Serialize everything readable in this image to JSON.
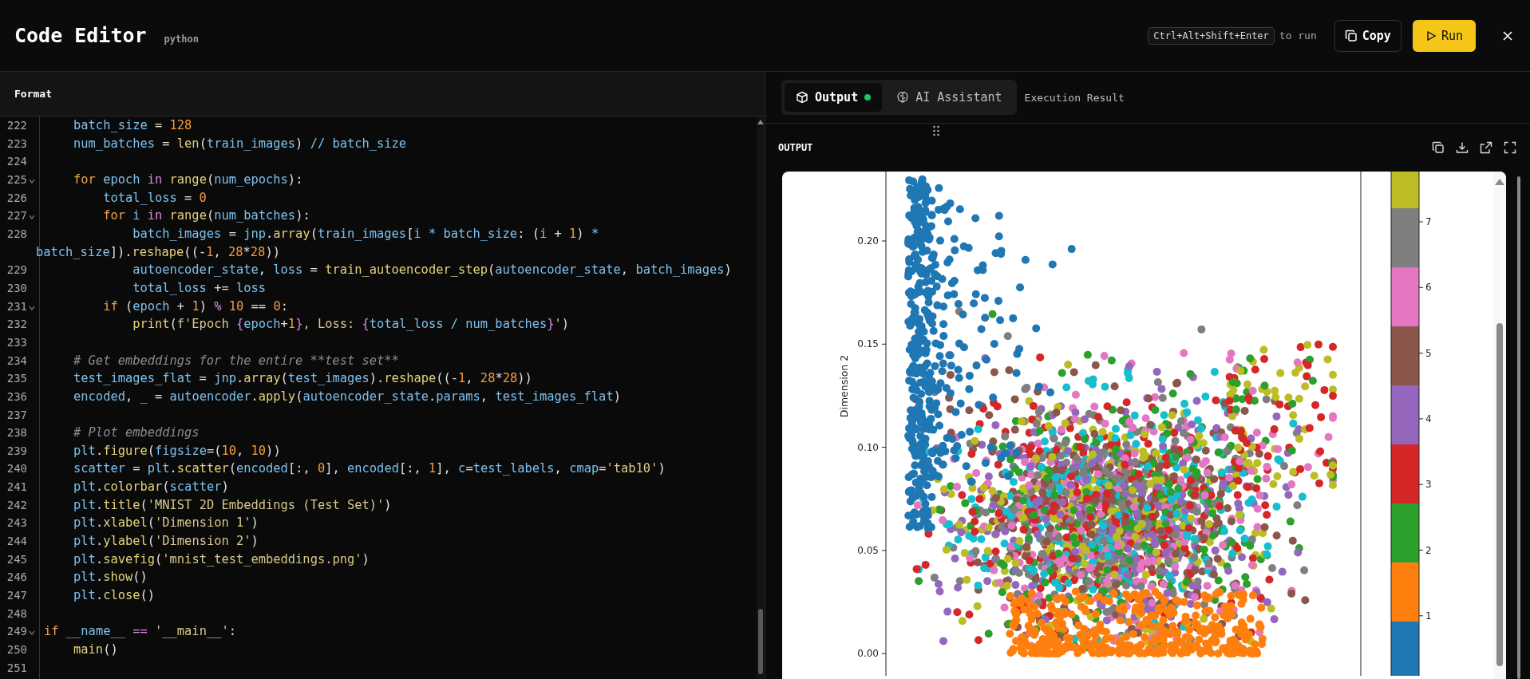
{
  "header": {
    "title": "Code Editor",
    "language": "python",
    "shortcut": "Ctrl+Alt+Shift+Enter",
    "shortcut_hint": "to run",
    "copy_button": "Copy",
    "run_button": "Run"
  },
  "editor": {
    "toolbar_label": "Format",
    "lines": [
      {
        "n": "222",
        "fold": false,
        "tokens": [
          {
            "text": "    batch_size",
            "kind": "variable"
          },
          {
            "text": " = ",
            "kind": "plain"
          },
          {
            "text": "128",
            "kind": "number"
          }
        ]
      },
      {
        "n": "223",
        "fold": false,
        "tokens": [
          {
            "text": "    num_batches",
            "kind": "variable"
          },
          {
            "text": " = ",
            "kind": "plain"
          },
          {
            "text": "len",
            "kind": "function"
          },
          {
            "text": "(",
            "kind": "plain"
          },
          {
            "text": "train_images",
            "kind": "variable"
          },
          {
            "text": ") ",
            "kind": "plain"
          },
          {
            "text": "// batch_size",
            "kind": "variable"
          }
        ]
      },
      {
        "n": "224",
        "fold": false
      },
      {
        "n": "225",
        "fold": true,
        "tokens": [
          {
            "text": "    for",
            "kind": "keyword"
          },
          {
            "text": " epoch ",
            "kind": "variable"
          },
          {
            "text": "in",
            "kind": "operator"
          },
          {
            "text": " range",
            "kind": "function"
          },
          {
            "text": "(",
            "kind": "plain"
          },
          {
            "text": "num_epochs",
            "kind": "variable"
          },
          {
            "text": "):",
            "kind": "plain"
          }
        ]
      },
      {
        "n": "226",
        "fold": false,
        "tokens": [
          {
            "text": "        total_loss",
            "kind": "variable"
          },
          {
            "text": " = ",
            "kind": "plain"
          },
          {
            "text": "0",
            "kind": "number"
          }
        ]
      },
      {
        "n": "227",
        "fold": true,
        "tokens": [
          {
            "text": "        for",
            "kind": "keyword"
          },
          {
            "text": " i ",
            "kind": "variable"
          },
          {
            "text": "in",
            "kind": "operator"
          },
          {
            "text": " range",
            "kind": "function"
          },
          {
            "text": "(",
            "kind": "plain"
          },
          {
            "text": "num_batches",
            "kind": "variable"
          },
          {
            "text": "):",
            "kind": "plain"
          }
        ]
      },
      {
        "n": "228",
        "fold": false,
        "tokens": [
          {
            "text": "            batch_images",
            "kind": "variable"
          },
          {
            "text": " = ",
            "kind": "plain"
          },
          {
            "text": "jnp",
            "kind": "variable"
          },
          {
            "text": ".",
            "kind": "plain"
          },
          {
            "text": "array",
            "kind": "function"
          },
          {
            "text": "(",
            "kind": "plain"
          },
          {
            "text": "train_images",
            "kind": "variable"
          },
          {
            "text": "[",
            "kind": "plain"
          },
          {
            "text": "i * batch_size",
            "kind": "variable"
          },
          {
            "text": ": (",
            "kind": "plain"
          },
          {
            "text": "i",
            "kind": "variable"
          },
          {
            "text": " + ",
            "kind": "plain"
          },
          {
            "text": "1",
            "kind": "number"
          },
          {
            "text": ") ",
            "kind": "plain"
          },
          {
            "text": "*",
            "kind": "variable"
          }
        ],
        "continuation": [
          {
            "text": "batch_size",
            "kind": "variable"
          },
          {
            "text": "]).",
            "kind": "plain"
          },
          {
            "text": "reshape",
            "kind": "function"
          },
          {
            "text": "((-",
            "kind": "plain"
          },
          {
            "text": "1",
            "kind": "number"
          },
          {
            "text": ", ",
            "kind": "plain"
          },
          {
            "text": "28",
            "kind": "number"
          },
          {
            "text": "*",
            "kind": "plain"
          },
          {
            "text": "28",
            "kind": "number"
          },
          {
            "text": "))",
            "kind": "plain"
          }
        ]
      },
      {
        "n": "229",
        "fold": false,
        "tokens": [
          {
            "text": "            autoencoder_state",
            "kind": "variable"
          },
          {
            "text": ", ",
            "kind": "plain"
          },
          {
            "text": "loss",
            "kind": "variable"
          },
          {
            "text": " = ",
            "kind": "plain"
          },
          {
            "text": "train_autoencoder_step",
            "kind": "function"
          },
          {
            "text": "(",
            "kind": "plain"
          },
          {
            "text": "autoencoder_state",
            "kind": "variable"
          },
          {
            "text": ", ",
            "kind": "plain"
          },
          {
            "text": "batch_images",
            "kind": "variable"
          },
          {
            "text": ")",
            "kind": "plain"
          }
        ]
      },
      {
        "n": "230",
        "fold": false,
        "tokens": [
          {
            "text": "            total_loss",
            "kind": "variable"
          },
          {
            "text": " += ",
            "kind": "plain"
          },
          {
            "text": "loss",
            "kind": "variable"
          }
        ]
      },
      {
        "n": "231",
        "fold": true,
        "tokens": [
          {
            "text": "        if",
            "kind": "keyword"
          },
          {
            "text": " (",
            "kind": "plain"
          },
          {
            "text": "epoch",
            "kind": "variable"
          },
          {
            "text": " + ",
            "kind": "plain"
          },
          {
            "text": "1",
            "kind": "number"
          },
          {
            "text": ") ",
            "kind": "plain"
          },
          {
            "text": "%",
            "kind": "operator"
          },
          {
            "text": " 10",
            "kind": "number"
          },
          {
            "text": " == ",
            "kind": "plain"
          },
          {
            "text": "0",
            "kind": "number"
          },
          {
            "text": ":",
            "kind": "plain"
          }
        ]
      },
      {
        "n": "232",
        "fold": false,
        "tokens": [
          {
            "text": "            print",
            "kind": "function"
          },
          {
            "text": "(",
            "kind": "plain"
          },
          {
            "text": "f'Epoch ",
            "kind": "string"
          },
          {
            "text": "{",
            "kind": "operator"
          },
          {
            "text": "epoch",
            "kind": "variable"
          },
          {
            "text": "+",
            "kind": "plain"
          },
          {
            "text": "1",
            "kind": "number"
          },
          {
            "text": "}",
            "kind": "operator"
          },
          {
            "text": ", Loss: ",
            "kind": "string"
          },
          {
            "text": "{",
            "kind": "operator"
          },
          {
            "text": "total_loss / num_batches",
            "kind": "variable"
          },
          {
            "text": "}",
            "kind": "operator"
          },
          {
            "text": "'",
            "kind": "string"
          },
          {
            "text": ")",
            "kind": "plain"
          }
        ]
      },
      {
        "n": "233",
        "fold": false
      },
      {
        "n": "234",
        "fold": false,
        "tokens": [
          {
            "text": "    # Get embeddings for the entire **test set**",
            "kind": "comment"
          }
        ]
      },
      {
        "n": "235",
        "fold": false,
        "tokens": [
          {
            "text": "    test_images_flat",
            "kind": "variable"
          },
          {
            "text": " = ",
            "kind": "plain"
          },
          {
            "text": "jnp",
            "kind": "variable"
          },
          {
            "text": ".",
            "kind": "plain"
          },
          {
            "text": "array",
            "kind": "function"
          },
          {
            "text": "(",
            "kind": "plain"
          },
          {
            "text": "test_images",
            "kind": "variable"
          },
          {
            "text": ").",
            "kind": "plain"
          },
          {
            "text": "reshape",
            "kind": "function"
          },
          {
            "text": "((-",
            "kind": "plain"
          },
          {
            "text": "1",
            "kind": "number"
          },
          {
            "text": ", ",
            "kind": "plain"
          },
          {
            "text": "28",
            "kind": "number"
          },
          {
            "text": "*",
            "kind": "plain"
          },
          {
            "text": "28",
            "kind": "number"
          },
          {
            "text": "))",
            "kind": "plain"
          }
        ]
      },
      {
        "n": "236",
        "fold": false,
        "tokens": [
          {
            "text": "    encoded",
            "kind": "variable"
          },
          {
            "text": ", ",
            "kind": "plain"
          },
          {
            "text": "_",
            "kind": "variable"
          },
          {
            "text": " = ",
            "kind": "plain"
          },
          {
            "text": "autoencoder",
            "kind": "variable"
          },
          {
            "text": ".",
            "kind": "plain"
          },
          {
            "text": "apply",
            "kind": "function"
          },
          {
            "text": "(",
            "kind": "plain"
          },
          {
            "text": "autoencoder_state",
            "kind": "variable"
          },
          {
            "text": ".",
            "kind": "plain"
          },
          {
            "text": "params",
            "kind": "variable"
          },
          {
            "text": ", ",
            "kind": "plain"
          },
          {
            "text": "test_images_flat",
            "kind": "variable"
          },
          {
            "text": ")",
            "kind": "plain"
          }
        ]
      },
      {
        "n": "237",
        "fold": false
      },
      {
        "n": "238",
        "fold": false,
        "tokens": [
          {
            "text": "    # Plot embeddings",
            "kind": "comment"
          }
        ]
      },
      {
        "n": "239",
        "fold": false,
        "tokens": [
          {
            "text": "    plt",
            "kind": "variable"
          },
          {
            "text": ".",
            "kind": "plain"
          },
          {
            "text": "figure",
            "kind": "function"
          },
          {
            "text": "(",
            "kind": "plain"
          },
          {
            "text": "figsize",
            "kind": "variable"
          },
          {
            "text": "=(",
            "kind": "plain"
          },
          {
            "text": "10",
            "kind": "number"
          },
          {
            "text": ", ",
            "kind": "plain"
          },
          {
            "text": "10",
            "kind": "number"
          },
          {
            "text": "))",
            "kind": "plain"
          }
        ]
      },
      {
        "n": "240",
        "fold": false,
        "tokens": [
          {
            "text": "    scatter",
            "kind": "variable"
          },
          {
            "text": " = ",
            "kind": "plain"
          },
          {
            "text": "plt",
            "kind": "variable"
          },
          {
            "text": ".",
            "kind": "plain"
          },
          {
            "text": "scatter",
            "kind": "function"
          },
          {
            "text": "(",
            "kind": "plain"
          },
          {
            "text": "encoded",
            "kind": "variable"
          },
          {
            "text": "[:, ",
            "kind": "plain"
          },
          {
            "text": "0",
            "kind": "number"
          },
          {
            "text": "], ",
            "kind": "plain"
          },
          {
            "text": "encoded",
            "kind": "variable"
          },
          {
            "text": "[:, ",
            "kind": "plain"
          },
          {
            "text": "1",
            "kind": "number"
          },
          {
            "text": "], ",
            "kind": "plain"
          },
          {
            "text": "c",
            "kind": "variable"
          },
          {
            "text": "=",
            "kind": "plain"
          },
          {
            "text": "test_labels",
            "kind": "variable"
          },
          {
            "text": ", ",
            "kind": "plain"
          },
          {
            "text": "cmap",
            "kind": "variable"
          },
          {
            "text": "=",
            "kind": "plain"
          },
          {
            "text": "'tab10'",
            "kind": "string"
          },
          {
            "text": ")",
            "kind": "plain"
          }
        ]
      },
      {
        "n": "241",
        "fold": false,
        "tokens": [
          {
            "text": "    plt",
            "kind": "variable"
          },
          {
            "text": ".",
            "kind": "plain"
          },
          {
            "text": "colorbar",
            "kind": "function"
          },
          {
            "text": "(",
            "kind": "plain"
          },
          {
            "text": "scatter",
            "kind": "variable"
          },
          {
            "text": ")",
            "kind": "plain"
          }
        ]
      },
      {
        "n": "242",
        "fold": false,
        "tokens": [
          {
            "text": "    plt",
            "kind": "variable"
          },
          {
            "text": ".",
            "kind": "plain"
          },
          {
            "text": "title",
            "kind": "function"
          },
          {
            "text": "(",
            "kind": "plain"
          },
          {
            "text": "'MNIST 2D Embeddings (Test Set)'",
            "kind": "string"
          },
          {
            "text": ")",
            "kind": "plain"
          }
        ]
      },
      {
        "n": "243",
        "fold": false,
        "tokens": [
          {
            "text": "    plt",
            "kind": "variable"
          },
          {
            "text": ".",
            "kind": "plain"
          },
          {
            "text": "xlabel",
            "kind": "function"
          },
          {
            "text": "(",
            "kind": "plain"
          },
          {
            "text": "'Dimension 1'",
            "kind": "string"
          },
          {
            "text": ")",
            "kind": "plain"
          }
        ]
      },
      {
        "n": "244",
        "fold": false,
        "tokens": [
          {
            "text": "    plt",
            "kind": "variable"
          },
          {
            "text": ".",
            "kind": "plain"
          },
          {
            "text": "ylabel",
            "kind": "function"
          },
          {
            "text": "(",
            "kind": "plain"
          },
          {
            "text": "'Dimension 2'",
            "kind": "string"
          },
          {
            "text": ")",
            "kind": "plain"
          }
        ]
      },
      {
        "n": "245",
        "fold": false,
        "tokens": [
          {
            "text": "    plt",
            "kind": "variable"
          },
          {
            "text": ".",
            "kind": "plain"
          },
          {
            "text": "savefig",
            "kind": "function"
          },
          {
            "text": "(",
            "kind": "plain"
          },
          {
            "text": "'mnist_test_embeddings.png'",
            "kind": "string"
          },
          {
            "text": ")",
            "kind": "plain"
          }
        ]
      },
      {
        "n": "246",
        "fold": false,
        "tokens": [
          {
            "text": "    plt",
            "kind": "variable"
          },
          {
            "text": ".",
            "kind": "plain"
          },
          {
            "text": "show",
            "kind": "function"
          },
          {
            "text": "()",
            "kind": "plain"
          }
        ]
      },
      {
        "n": "247",
        "fold": false,
        "tokens": [
          {
            "text": "    plt",
            "kind": "variable"
          },
          {
            "text": ".",
            "kind": "plain"
          },
          {
            "text": "close",
            "kind": "function"
          },
          {
            "text": "()",
            "kind": "plain"
          }
        ]
      },
      {
        "n": "248",
        "fold": false
      },
      {
        "n": "249",
        "fold": true,
        "tokens": [
          {
            "text": "if",
            "kind": "keyword"
          },
          {
            "text": " __name__ ",
            "kind": "variable"
          },
          {
            "text": "==",
            "kind": "operator"
          },
          {
            "text": " '__main__'",
            "kind": "string"
          },
          {
            "text": ":",
            "kind": "plain"
          }
        ]
      },
      {
        "n": "250",
        "fold": false,
        "tokens": [
          {
            "text": "    main",
            "kind": "function"
          },
          {
            "text": "()",
            "kind": "plain"
          }
        ]
      },
      {
        "n": "251",
        "fold": false
      }
    ]
  },
  "output_panel": {
    "tabs": [
      {
        "label": "Output",
        "kind": "output",
        "selected": true,
        "live": true
      },
      {
        "label": "AI Assistant",
        "kind": "assistant",
        "selected": false,
        "live": false
      }
    ],
    "execution_label": "Execution Result",
    "section_title": "OUTPUT",
    "plot": {
      "ylabel": "Dimension 2",
      "yticks": [
        "0.20",
        "0.15",
        "0.10",
        "0.05",
        "0.00"
      ],
      "colorbar_ticks": [
        "7",
        "6",
        "5",
        "4",
        "3",
        "2",
        "1"
      ]
    }
  }
}
